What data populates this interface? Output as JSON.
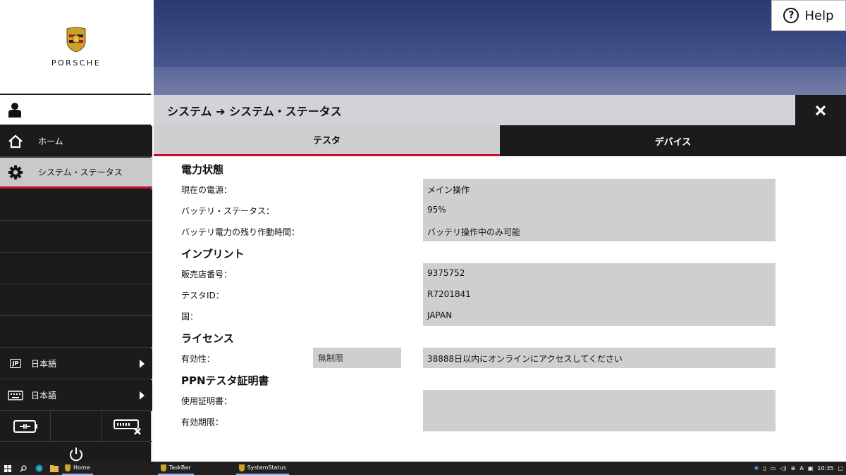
{
  "brand": {
    "wordmark": "PORSCHE"
  },
  "help": {
    "label": "Help"
  },
  "sidebar": {
    "items": [
      {
        "label": "ホーム",
        "icon": "home-icon"
      },
      {
        "label": "システム・ステータス",
        "icon": "gear-icon"
      }
    ],
    "languages": [
      {
        "badge": "JP",
        "label": "日本語"
      },
      {
        "label": "日本語"
      }
    ]
  },
  "header": {
    "breadcrumb": "システム ➔ システム・ステータス"
  },
  "tabs": [
    {
      "label": "テスタ",
      "active": true
    },
    {
      "label": "デバイス",
      "active": false
    }
  ],
  "sections": {
    "power": {
      "title": "電力状態",
      "fields": [
        {
          "label": "現在の電源：",
          "value": "メイン操作"
        },
        {
          "label": "バッテリ・ステータス：",
          "value": "95%"
        },
        {
          "label": "バッテリ電力の残り作動時間：",
          "value": "バッテリ操作中のみ可能"
        }
      ]
    },
    "imprint": {
      "title": "インプリント",
      "fields": [
        {
          "label": "販売店番号：",
          "value": "9375752"
        },
        {
          "label": "テスタID：",
          "value": "R7201841"
        },
        {
          "label": "国：",
          "value": "JAPAN"
        }
      ]
    },
    "license": {
      "title": "ライセンス",
      "fields": [
        {
          "label": "有効性：",
          "short_value": "無制限",
          "value": "38888日以内にオンラインにアクセスしてください"
        }
      ]
    },
    "certificate": {
      "title": "PPNテスタ証明書",
      "fields": [
        {
          "label": "使用証明書：",
          "value": ""
        },
        {
          "label": "有効期限：",
          "value": ""
        }
      ]
    }
  },
  "taskbar": {
    "apps": [
      {
        "label": "Home"
      },
      {
        "label": "TaskBar"
      },
      {
        "label": "SystemStatus"
      }
    ],
    "clock": "10:35"
  },
  "colors": {
    "accent_red": "#c8102e",
    "sidebar_bg": "#1b1b1b",
    "field_bg": "#cfcfcf"
  }
}
